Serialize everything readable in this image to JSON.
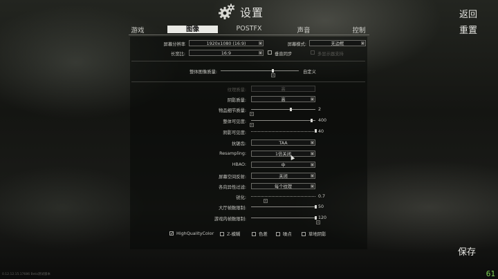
{
  "header": {
    "title": "设置",
    "icon": "gear-icon"
  },
  "side": {
    "back": "返回",
    "reset": "重置",
    "save": "保存"
  },
  "tabs": [
    {
      "label": "游戏",
      "active": false
    },
    {
      "label": "图像",
      "active": true
    },
    {
      "label": "POSTFX",
      "active": false
    },
    {
      "label": "声音",
      "active": false
    },
    {
      "label": "控制",
      "active": false
    }
  ],
  "top_settings": {
    "resolution_label": "屏幕分辨率",
    "resolution_value": "1920x1080 (16:9)",
    "screen_mode_label": "屏幕模式:",
    "screen_mode_value": "无边框",
    "aspect_label": "长宽比:",
    "aspect_value": "16:9",
    "vsync_label": "垂直同步",
    "vsync_checked": false,
    "multimonitor_label": "多显示器支持",
    "multimonitor_checked": false
  },
  "overall": {
    "label": "整体图像质量:",
    "value": "自定义"
  },
  "settings": {
    "texture": {
      "label": "纹理质量:",
      "value": "高"
    },
    "shadow": {
      "label": "阴影质量:",
      "value": "高"
    },
    "object_lod": {
      "label": "物品细节质量:",
      "value": "2",
      "fraction": 0.6
    },
    "visibility": {
      "label": "整体可见度:",
      "value": "400",
      "fraction": 0.93
    },
    "shadow_visibility": {
      "label": "阴影可见度:",
      "value": "40"
    },
    "aa": {
      "label": "抗锯齿:",
      "value": "TAA"
    },
    "resampling": {
      "label": "Resampling:",
      "value": "1倍关闭"
    },
    "hbao": {
      "label": "HBAO:",
      "value": "中"
    },
    "ssr": {
      "label": "屏幕空间反射:",
      "value": "关闭"
    },
    "aniso": {
      "label": "各向异性过滤:",
      "value": "每个纹理"
    },
    "sharpen": {
      "label": "锐化:",
      "value": "0.7"
    },
    "lobby_fps": {
      "label": "大厅帧数限制:",
      "value": "50"
    },
    "game_fps": {
      "label": "游戏内帧数限制:",
      "value": "120"
    }
  },
  "bottom_checks": [
    {
      "label": "HighQualityColor",
      "checked": true
    },
    {
      "label": "Z-模糊",
      "checked": false
    },
    {
      "label": "色差",
      "checked": false
    },
    {
      "label": "噪点",
      "checked": false
    },
    {
      "label": "草地阴影",
      "checked": false
    }
  ],
  "footer": {
    "version": "0.12.12.15.17686 Beta测试版本",
    "fps": "61"
  },
  "colors": {
    "fps": "#82d657",
    "active_tab_bg": "#e9e9e4"
  }
}
